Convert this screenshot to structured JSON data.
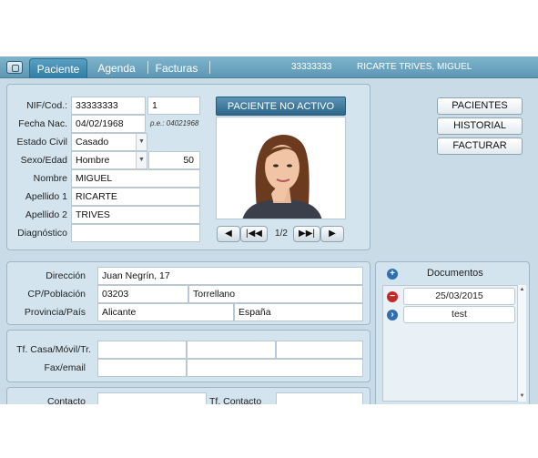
{
  "tabs": [
    "Paciente",
    "Agenda",
    "Facturas"
  ],
  "header": {
    "patient_id": "33333333",
    "patient_name": "RICARTE TRIVES, MIGUEL"
  },
  "patient": {
    "labels": {
      "nif": "NIF/Cod.:",
      "birth": "Fecha Nac.",
      "civil": "Estado Civil",
      "sex_age": "Sexo/Edad",
      "name": "Nombre",
      "surname1": "Apellido 1",
      "surname2": "Apellido 2",
      "diagnosis": "Diagnóstico"
    },
    "nif": "33333333",
    "code": "1",
    "birth_date": "04/02/1968",
    "birth_hint": "p.e.: 04021968",
    "civil_status": "Casado",
    "sex": "Hombre",
    "age": "50",
    "name": "MIGUEL",
    "surname1": "RICARTE",
    "surname2": "TRIVES",
    "diagnosis": ""
  },
  "status_button": "PACIENTE NO ACTIVO",
  "photo": {
    "page": "1/2"
  },
  "side_buttons": [
    "PACIENTES",
    "HISTORIAL",
    "FACTURAR"
  ],
  "address": {
    "labels": {
      "address": "Dirección",
      "cp_city": "CP/Población",
      "province_country": "Provincia/País"
    },
    "street": "Juan Negrín, 17",
    "cp": "03203",
    "city": "Torrellano",
    "province": "Alicante",
    "country": "España"
  },
  "contact": {
    "labels": {
      "phones": "Tf. Casa/Móvil/Tr.",
      "fax_email": "Fax/email",
      "contact": "Contacto",
      "contact_phone": "Tf. Contacto"
    }
  },
  "documents": {
    "title": "Documentos",
    "items": [
      "25/03/2015",
      "test"
    ]
  },
  "colors": {
    "tabbar": "#5d98b5",
    "panel": "#d4e4ee",
    "status_button": "#2d6688",
    "remove_icon": "#c62828",
    "go_icon": "#2f6fb0"
  }
}
